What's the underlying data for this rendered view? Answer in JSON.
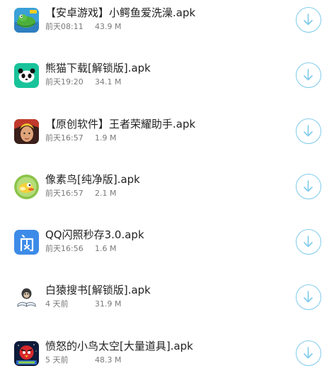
{
  "accent_color": "#7ecbea",
  "apps": [
    {
      "title": "【安卓游戏】小鳄鱼爱洗澡.apk",
      "time": "前天08:11",
      "size": "43.9 M",
      "icon": "crocodile-game-icon"
    },
    {
      "title": "熊猫下载[解锁版].apk",
      "time": "前天19:20",
      "size": "34.1 M",
      "icon": "panda-icon"
    },
    {
      "title": "【原创软件】王者荣耀助手.apk",
      "time": "前天16:57",
      "size": "1.9 M",
      "icon": "hero-avatar-icon"
    },
    {
      "title": "像素鸟[纯净版].apk",
      "time": "前天16:57",
      "size": "2.1 M",
      "icon": "flappy-bird-icon"
    },
    {
      "title": "QQ闪照秒存3.0.apk",
      "time": "前天16:56",
      "size": "1.6 M",
      "icon": "flash-char-icon"
    },
    {
      "title": "白猿搜书[解锁版].apk",
      "time": "4 天前",
      "size": "31.9 M",
      "icon": "ape-reading-icon"
    },
    {
      "title": "愤怒的小鸟太空[大量道具].apk",
      "time": "5 天前",
      "size": "48.3 M",
      "icon": "angry-birds-space-icon"
    }
  ],
  "download_icon": "download-arrow-icon"
}
